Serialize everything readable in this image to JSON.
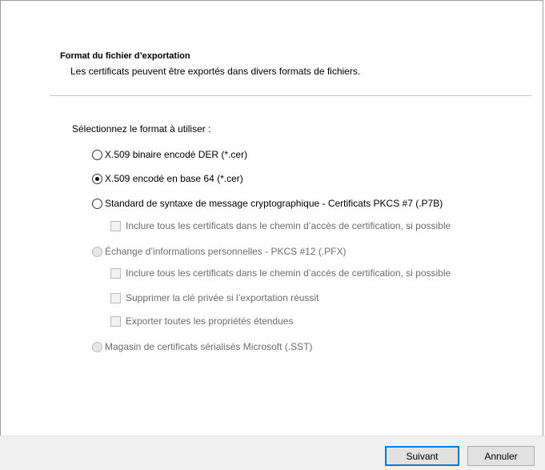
{
  "header": {
    "title": "Format du fichier d’exportation",
    "description": "Les certificats peuvent être exportés dans divers formats de fichiers."
  },
  "prompt": "Sélectionnez le format à utiliser :",
  "options": {
    "der": {
      "label": "X.509 binaire encodé DER (*.cer)",
      "checked": false,
      "enabled": true
    },
    "base64": {
      "label": "X.509 encodé en base 64 (*.cer)",
      "checked": true,
      "enabled": true
    },
    "pkcs7": {
      "label": "Standard de syntaxe de message cryptographique - Certificats PKCS #7 (.P7B)",
      "checked": false,
      "enabled": true
    },
    "pkcs7_include": {
      "label": "Inclure tous les certificats dans le chemin d’accès de certification, si possible",
      "enabled": false
    },
    "pfx": {
      "label": "Échange d’informations personnelles - PKCS #12 (.PFX)",
      "checked": false,
      "enabled": false
    },
    "pfx_include": {
      "label": "Inclure tous les certificats dans le chemin d’accès de certification, si possible",
      "enabled": false
    },
    "pfx_delete_key": {
      "label": "Supprimer la clé privée si l’exportation réussit",
      "enabled": false
    },
    "pfx_export_props": {
      "label": "Exporter toutes les propriétés étendues",
      "enabled": false
    },
    "sst": {
      "label": "Magasin de certificats sérialisés Microsoft (.SST)",
      "checked": false,
      "enabled": false
    }
  },
  "buttons": {
    "next": "Suivant",
    "cancel": "Annuler"
  }
}
